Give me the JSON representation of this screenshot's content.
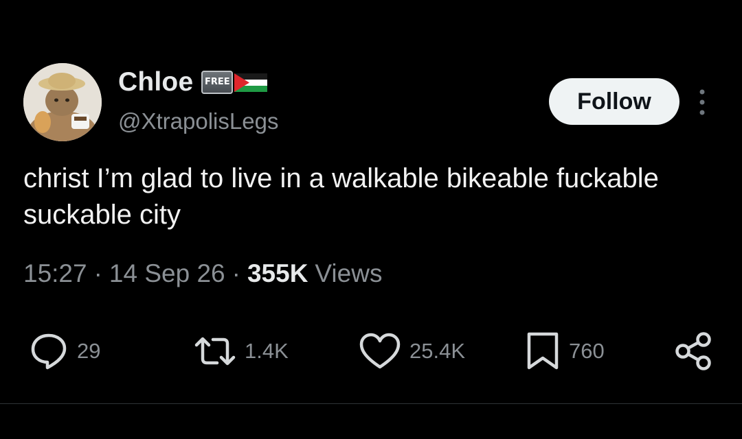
{
  "user": {
    "display_name": "Chloe",
    "badge_text": "FREE",
    "handle": "@XtrapolisLegs"
  },
  "follow_label": "Follow",
  "tweet": {
    "text": "christ I’m glad to live in a walkable bikeable fuckable suckable city"
  },
  "meta": {
    "time": "15:27",
    "date": "14 Sep 26",
    "views_count": "355K",
    "views_label": "Views",
    "separator": "·"
  },
  "actions": {
    "replies": "29",
    "reposts": "1.4K",
    "likes": "25.4K",
    "bookmarks": "760"
  },
  "colors": {
    "background": "#000000",
    "text": "#e7e9ea",
    "secondary": "#8b9095",
    "button_bg": "#eff3f4"
  },
  "icons": [
    "reply-icon",
    "repost-icon",
    "like-icon",
    "bookmark-icon",
    "share-icon",
    "more-icon",
    "palestine-flag-icon"
  ]
}
